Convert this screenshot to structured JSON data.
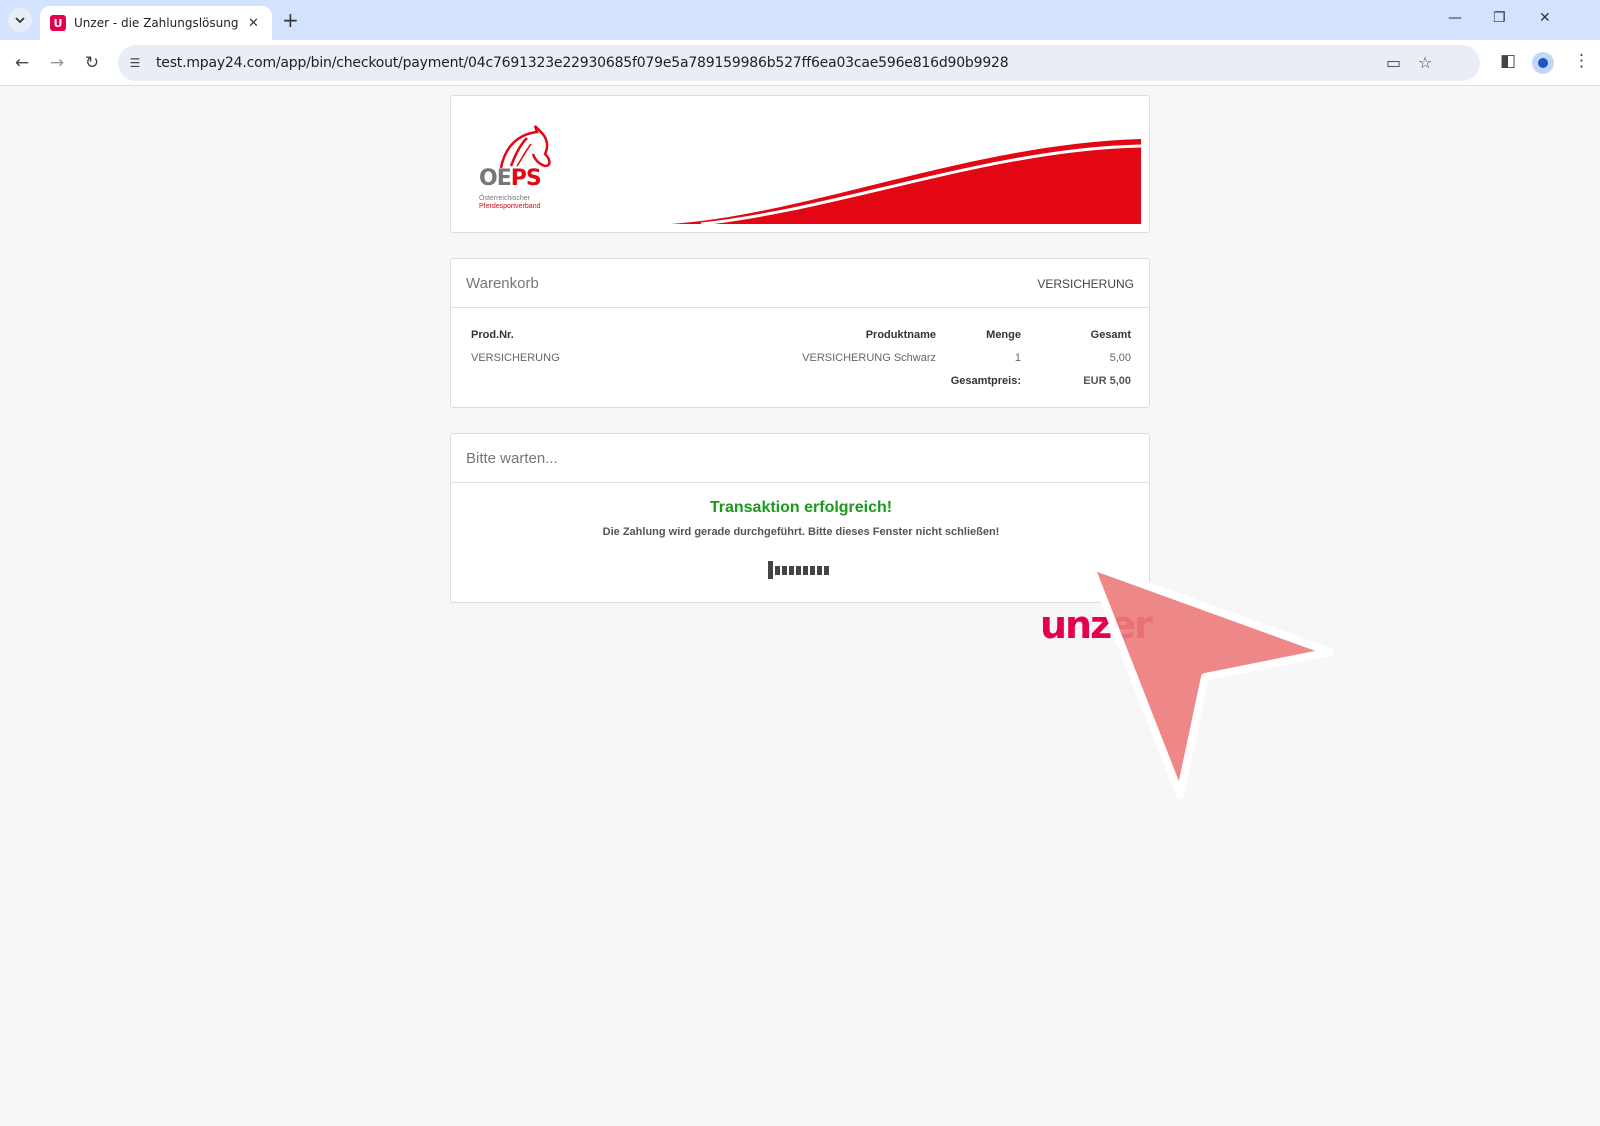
{
  "browser": {
    "tab_title": "Unzer - die Zahlungslösung für",
    "favicon_letter": "U",
    "url": "test.mpay24.com/app/bin/checkout/payment/04c7691323e22930685f079e5a789159986b527ff6ea03cae596e816d90b9928"
  },
  "icons": {
    "tab_list": "chevron-down-icon",
    "tab_close": "close-icon",
    "new_tab": "plus-icon",
    "minimize": "minimize-icon",
    "restore": "restore-icon",
    "close": "close-icon",
    "back": "arrow-left-icon",
    "forward": "arrow-right-icon",
    "reload": "reload-icon",
    "site_info": "tune-icon",
    "card": "credit-card-icon",
    "bookmark": "star-icon",
    "side_panel": "side-panel-icon",
    "profile": "profile-icon",
    "menu": "more-vert-icon"
  },
  "banner": {
    "logo_text_oe": "OE",
    "logo_text_ps": "PS",
    "logo_subtitle_1": "Österreichischer",
    "logo_subtitle_2": "Pferdesportverband",
    "brand_color": "#e30613"
  },
  "cart": {
    "title": "Warenkorb",
    "tag": "VERSICHERUNG",
    "columns": [
      "Prod.Nr.",
      "Produktname",
      "Menge",
      "Gesamt"
    ],
    "items": [
      {
        "prod_nr": "VERSICHERUNG",
        "name": "VERSICHERUNG Schwarz",
        "qty": "1",
        "total": "5,00"
      }
    ],
    "total_label": "Gesamtpreis:",
    "total_value": "EUR 5,00"
  },
  "status": {
    "title": "Bitte warten...",
    "success": "Transaktion erfolgreich!",
    "hint": "Die Zahlung wird gerade durchgeführt. Bitte dieses Fenster nicht schließen!",
    "success_color": "#1a9a1a"
  },
  "footer": {
    "logo": "unzer",
    "logo_color": "#e5004f"
  }
}
